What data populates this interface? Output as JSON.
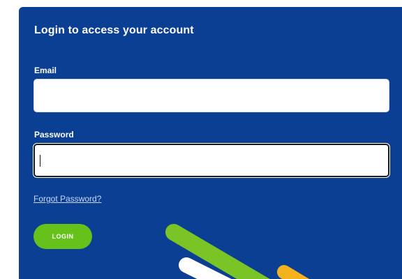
{
  "login": {
    "title": "Login to access your account",
    "email_label": "Email",
    "email_value": "",
    "password_label": "Password",
    "password_value": "",
    "forgot_link": "Forgot Password?",
    "login_button": "LOGIN"
  },
  "colors": {
    "panel_background": "#0b3f93",
    "button_green": "#66c21a",
    "stripe_green": "#7ac425",
    "stripe_white": "#ffffff",
    "stripe_yellow": "#f3b21c"
  }
}
